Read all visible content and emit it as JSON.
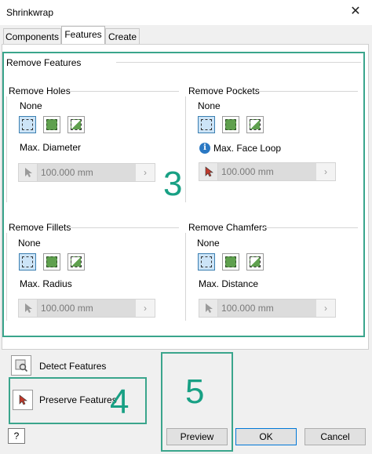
{
  "window": {
    "title": "Shrinkwrap",
    "close_glyph": "✕"
  },
  "tabs": [
    {
      "label": "Components",
      "active": false
    },
    {
      "label": "Features",
      "active": true
    },
    {
      "label": "Create",
      "active": false
    }
  ],
  "remove_features": {
    "title": "Remove Features",
    "holes": {
      "title": "Remove Holes",
      "option": "None",
      "param_label": "Max. Diameter",
      "value": "100.000 mm"
    },
    "pockets": {
      "title": "Remove Pockets",
      "option": "None",
      "param_label": "Max. Face Loop",
      "value": "100.000 mm"
    },
    "fillets": {
      "title": "Remove Fillets",
      "option": "None",
      "param_label": "Max. Radius",
      "value": "100.000 mm"
    },
    "chamfers": {
      "title": "Remove Chamfers",
      "option": "None",
      "param_label": "Max. Distance",
      "value": "100.000 mm"
    }
  },
  "detect_features": {
    "label": "Detect Features"
  },
  "preserve_features": {
    "label": "Preserve Features"
  },
  "callouts": {
    "three": "3",
    "four": "4",
    "five": "5"
  },
  "buttons": {
    "preview": "Preview",
    "ok": "OK",
    "cancel": "Cancel"
  },
  "colors": {
    "highlight": "#3aa58c",
    "callout_text": "#18a084",
    "icon_green": "#5fa04e",
    "selected_bg": "#cce4f7"
  },
  "icons": [
    "none-icon",
    "remove-all-icon",
    "remove-by-size-icon",
    "select-arrow-icon",
    "info-icon",
    "detect-features-icon",
    "help-icon"
  ]
}
